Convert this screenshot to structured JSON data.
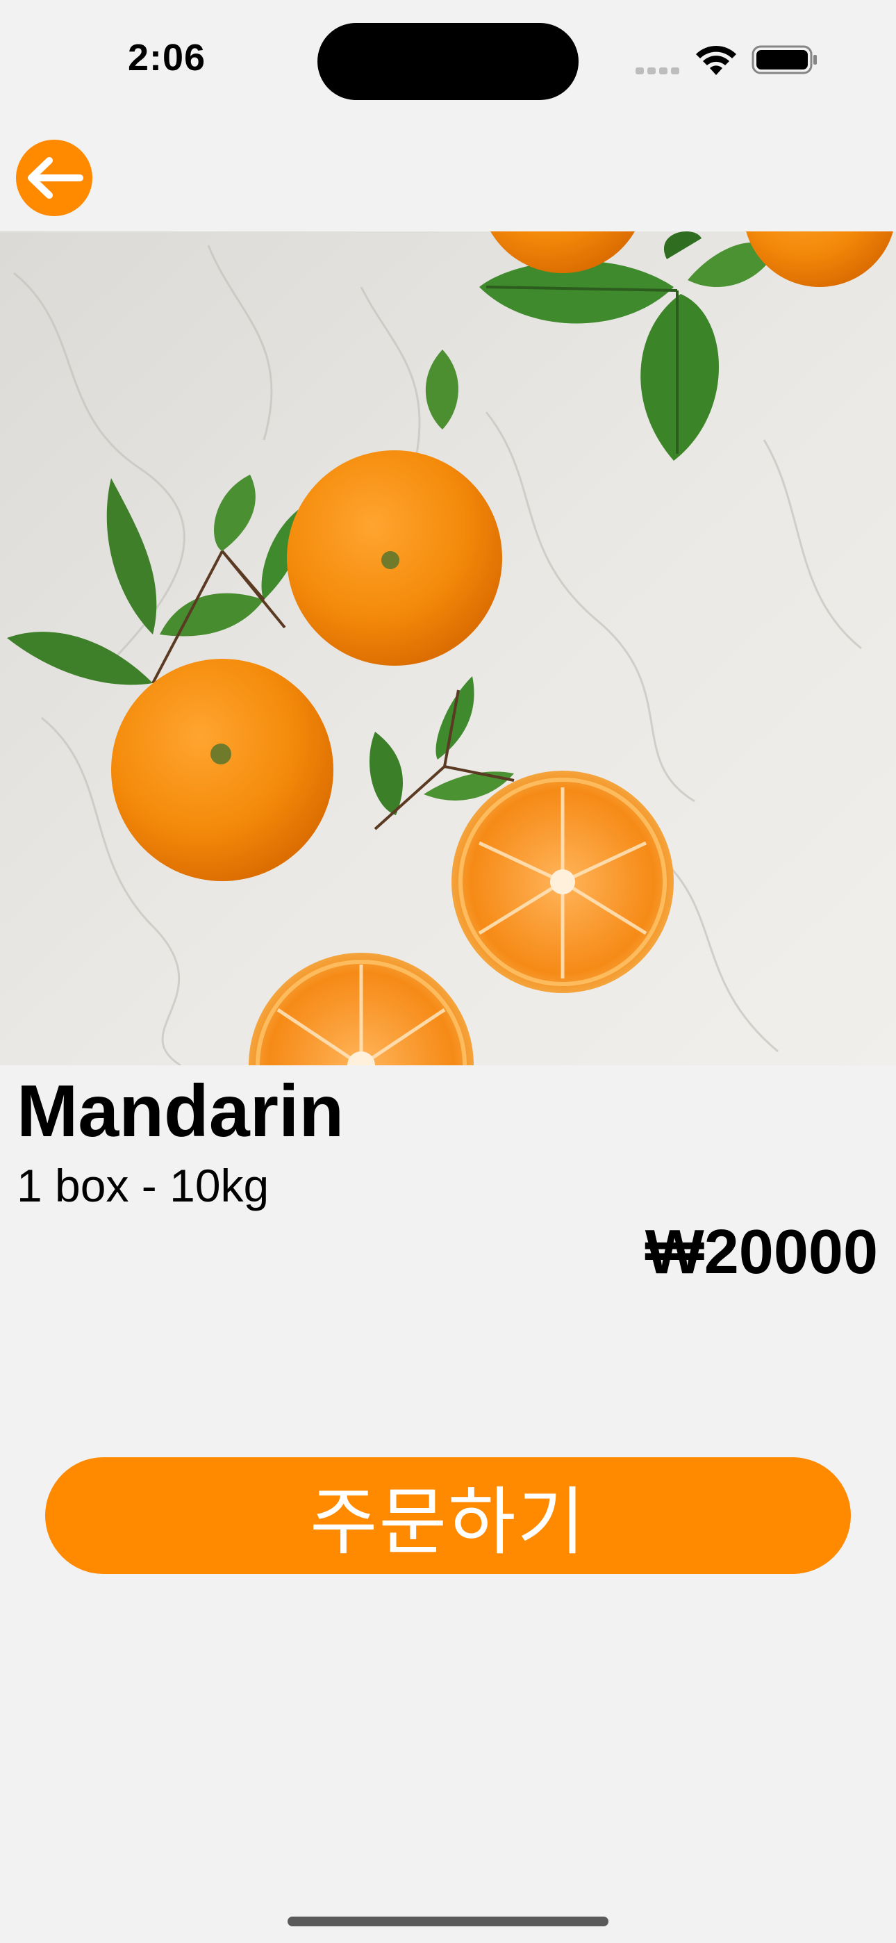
{
  "status_bar": {
    "time": "2:06"
  },
  "nav": {
    "back_icon": "arrow-left-icon"
  },
  "product": {
    "name": "Mandarin",
    "subtitle": "1 box - 10kg",
    "price": "₩20000"
  },
  "actions": {
    "order_label": "주문하기"
  },
  "colors": {
    "accent": "#ff8a00",
    "background": "#f2f2f2"
  }
}
